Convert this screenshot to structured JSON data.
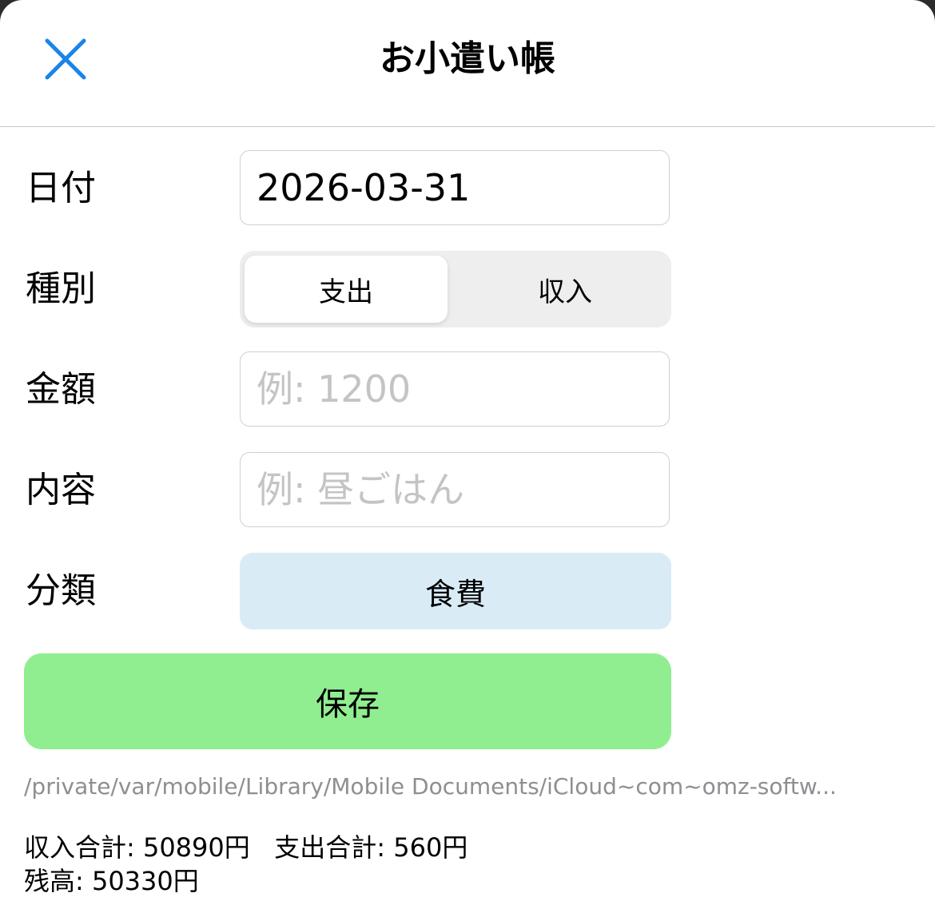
{
  "header": {
    "title": "お小遣い帳",
    "close_icon": "close-icon",
    "accent_color": "#1a84e8"
  },
  "form": {
    "date": {
      "label": "日付",
      "value": "2026-03-31"
    },
    "type": {
      "label": "種別",
      "options": [
        "支出",
        "収入"
      ],
      "selected": "支出"
    },
    "amount": {
      "label": "金額",
      "value": "",
      "placeholder": "例: 1200"
    },
    "description": {
      "label": "内容",
      "value": "",
      "placeholder": "例: 昼ごはん"
    },
    "category": {
      "label": "分類",
      "value": "食費",
      "color": "#d9ecf6"
    }
  },
  "save": {
    "label": "保存",
    "color": "#91ee90"
  },
  "file_path": "/private/var/mobile/Library/Mobile Documents/iCloud~com~omz-softw...",
  "summary": {
    "income_total": "収入合計: 50890円",
    "expense_total": "支出合計: 560円",
    "balance": "残高: 50330円"
  }
}
